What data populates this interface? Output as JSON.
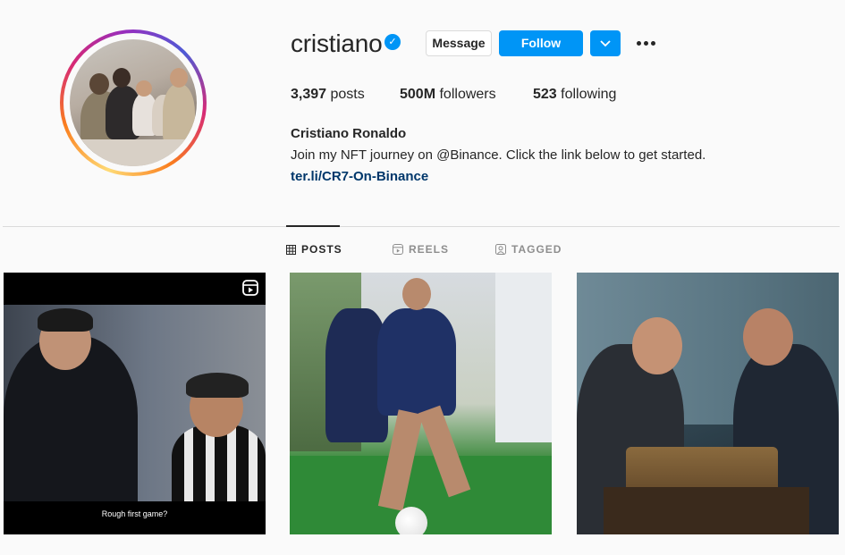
{
  "profile": {
    "username": "cristiano",
    "verified_icon": "verified-badge-icon",
    "buttons": {
      "message": "Message",
      "follow": "Follow",
      "suggest_icon": "chevron-down-icon",
      "more_icon": "more-options-icon"
    },
    "stats": {
      "posts_count": "3,397",
      "posts_label": "posts",
      "followers_count": "500M",
      "followers_label": "followers",
      "following_count": "523",
      "following_label": "following"
    },
    "full_name": "Cristiano Ronaldo",
    "bio": "Join my NFT journey on @Binance. Click the link below to get started.",
    "link": "ter.li/CR7-On-Binance"
  },
  "tabs": [
    {
      "label": "POSTS",
      "icon": "grid-icon",
      "active": true
    },
    {
      "label": "REELS",
      "icon": "reels-icon",
      "active": false
    },
    {
      "label": "TAGGED",
      "icon": "tagged-icon",
      "active": false
    }
  ],
  "posts": [
    {
      "type": "reel",
      "icon": "reels-icon",
      "caption": "Rough first game?"
    },
    {
      "type": "photo"
    },
    {
      "type": "photo"
    }
  ],
  "colors": {
    "primary": "#0095f6",
    "text": "#262626",
    "muted": "#8e8e8e",
    "link": "#00376b",
    "background": "#fafafa"
  }
}
